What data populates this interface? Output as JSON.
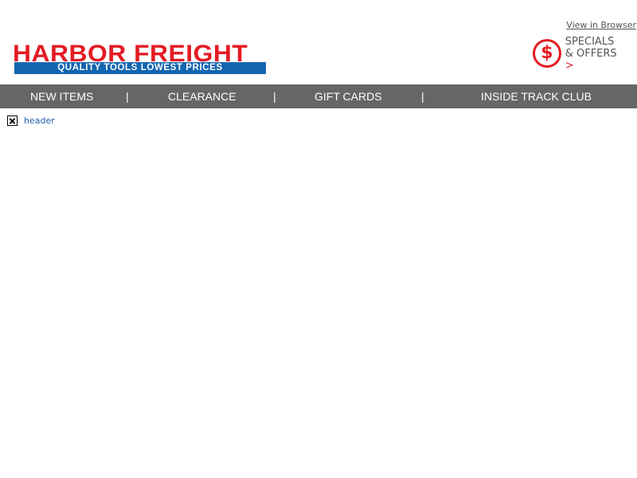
{
  "header": {
    "view_in_browser": "View in Browser",
    "logo": {
      "title": "HARBOR FREIGHT",
      "tagline": "QUALITY TOOLS   LOWEST PRICES"
    },
    "specials": {
      "icon": "dollar-circle-icon",
      "line1": "SPECIALS",
      "line2": "& OFFERS",
      "arrow": ">"
    }
  },
  "nav": {
    "items": [
      "NEW ITEMS",
      "CLEARANCE",
      "GIFT CARDS",
      "INSIDE TRACK CLUB"
    ],
    "separator": "|"
  },
  "content": {
    "broken_image_alt": "header"
  },
  "colors": {
    "brand_red": "#e31b23",
    "brand_blue": "#1466b0",
    "nav_bg": "#666666"
  }
}
